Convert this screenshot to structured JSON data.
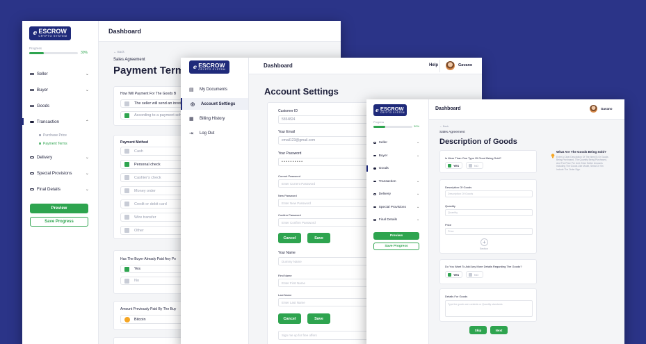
{
  "brand": {
    "name": "ESCROW",
    "tagline": "CRYPTO SYSTEM",
    "mark": "e"
  },
  "user": {
    "name": "Gavano"
  },
  "colors": {
    "background": "#2b3488",
    "accent": "#2ea44f",
    "brand": "#1f2a7a"
  },
  "w1": {
    "title": "Dashboard",
    "progress_label": "Progress",
    "progress_value": "30%",
    "progress_fraction": 0.3,
    "nav": [
      {
        "label": "Seller",
        "chevron": "⌄"
      },
      {
        "label": "Buyer",
        "chevron": "⌄"
      },
      {
        "label": "Goods",
        "chevron": ""
      },
      {
        "label": "Transaction",
        "chevron": "⌃"
      },
      {
        "label": "Delivery",
        "chevron": "⌄"
      },
      {
        "label": "Special Provisions",
        "chevron": "⌄"
      },
      {
        "label": "Final Details",
        "chevron": "⌄"
      }
    ],
    "subnav": [
      "Purchase Price",
      "Payment Terms"
    ],
    "preview": "Preview",
    "save": "Save Progress",
    "back": "← Back",
    "crumb": "Sales Agreement",
    "heading": "Payment Terms",
    "q1": "How Will Payment For The Goods B",
    "q1_options": [
      "The seller will send an invoice",
      "According to a payment sche"
    ],
    "method_label": "Payment Method",
    "methods": [
      "Cash",
      "Personal check",
      "Cashier's check",
      "Money order",
      "Credit or debit card",
      "Wire transfer",
      "Other"
    ],
    "q2": "Has The Buyer Already Paid Any Po",
    "q2_options": [
      "Yes",
      "No"
    ],
    "q3": "Amount Previously Paid By The Buy",
    "q3_value": "Bitcoin"
  },
  "w2": {
    "title": "Dashboard",
    "help": "Help",
    "nav": [
      "My Documents",
      "Account Settings",
      "Billing History",
      "Log Out"
    ],
    "heading": "Account Settings",
    "customer_id_label": "Customer ID",
    "customer_id": "5554824",
    "email_label": "Your Email",
    "email": "email123@gmail.com",
    "password_label": "Your Password",
    "password": "• • • • • • • • • •",
    "current_pw_label": "Current Password",
    "current_pw_ph": "Enter Current Password",
    "new_pw_label": "New Password",
    "new_pw_ph": "Enter New Password",
    "confirm_pw_label": "Confirm Password",
    "confirm_pw_ph": "Enter Confirm Password",
    "cancel": "Cancel",
    "save": "Save",
    "name_label": "Your Name",
    "name_ph": "Dummy Name",
    "first_label": "First Name",
    "first_ph": "Enter First Name",
    "last_label": "Last Name",
    "last_ph": "Enter Last Name",
    "signup": "Sign me up for free offers"
  },
  "w3": {
    "title": "Dashboard",
    "progress_label": "Progress",
    "progress_value": "30%",
    "progress_fraction": 0.3,
    "nav": [
      {
        "label": "Seller",
        "chevron": "⌄"
      },
      {
        "label": "Buyer",
        "chevron": "⌄"
      },
      {
        "label": "Goods",
        "chevron": ""
      },
      {
        "label": "Transaction",
        "chevron": "⌄"
      },
      {
        "label": "Delivery",
        "chevron": "⌄"
      },
      {
        "label": "Special Provisions",
        "chevron": "⌄"
      },
      {
        "label": "Final Details",
        "chevron": "⌄"
      }
    ],
    "preview": "Preview",
    "save": "Save Progress",
    "back": "← Back",
    "crumb": "Sales Agreement",
    "heading": "Description of Goods",
    "q1": "Is More Than One Type Of Good Being Sold?",
    "yes": "YES",
    "no": "NO",
    "desc_label": "Description Of Goods",
    "desc_ph": "Description Of Goods",
    "qty_label": "Quantity",
    "qty_ph": "Quantity",
    "price_label": "Price",
    "price_ph": "Price",
    "add_icon": "+",
    "add_label": "Section",
    "q2": "Do You Want To Add Any More Details Regarding The Goods?",
    "details_label": "Details For Goods",
    "details_ph": "Type the goods are contents or Quantity standards",
    "skip": "Skip",
    "next": "Next",
    "tip_title": "What Are The Goods Being Sold?",
    "tip_body": "Enter A Clear Description Of The Item(S) Or Goods Being Purchased, The Quantity Being Purchased, And The Price Per Unit. Enter Better Amounts Including The Goods Like Model, Serial Or Vin Include The Order Sign."
  }
}
